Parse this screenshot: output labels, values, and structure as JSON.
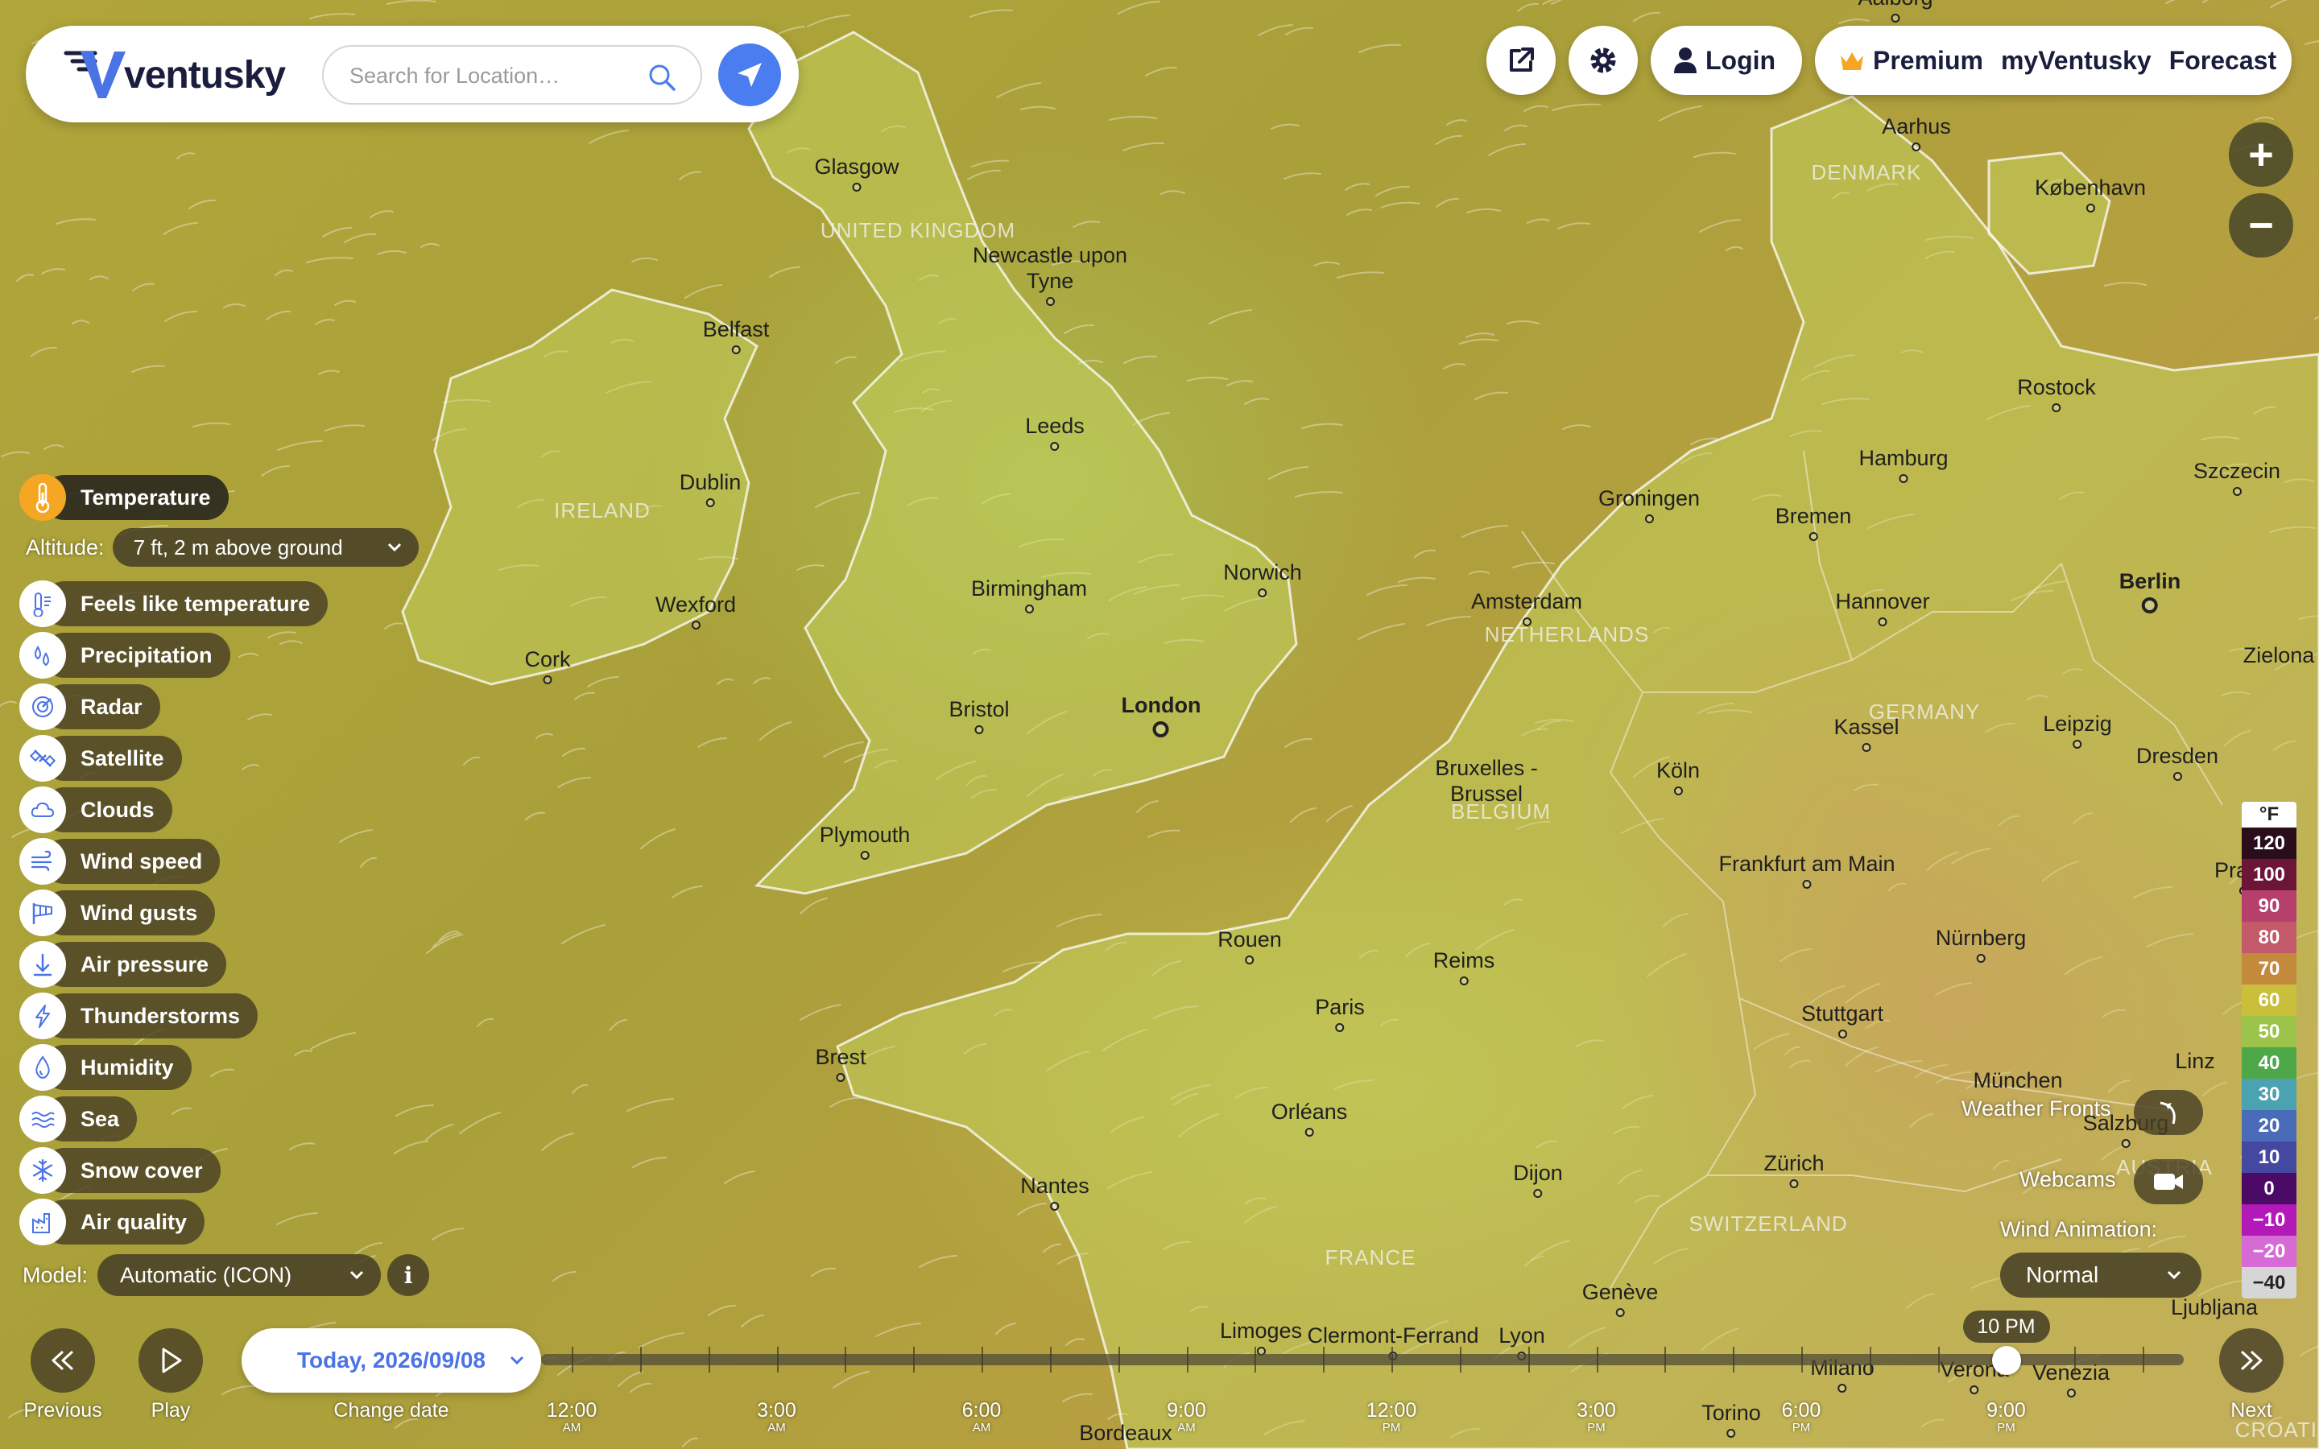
{
  "header": {
    "brand": "ventusky",
    "search_placeholder": "Search for Location…",
    "login_label": "Login",
    "premium_label": "Premium",
    "my_label": "myVentusky",
    "forecast_label": "Forecast"
  },
  "colors": {
    "accent": "#4a7df0",
    "active_layer": "#f5a623"
  },
  "layers": {
    "active": "Temperature",
    "altitude_label": "Altitude:",
    "altitude_value": "7 ft, 2 m above ground",
    "items": [
      {
        "label": "Feels like temperature",
        "icon": "thermometer-lines-icon"
      },
      {
        "label": "Precipitation",
        "icon": "drops-icon"
      },
      {
        "label": "Radar",
        "icon": "radar-icon"
      },
      {
        "label": "Satellite",
        "icon": "satellite-icon"
      },
      {
        "label": "Clouds",
        "icon": "cloud-icon"
      },
      {
        "label": "Wind speed",
        "icon": "wind-icon"
      },
      {
        "label": "Wind gusts",
        "icon": "windsock-icon"
      },
      {
        "label": "Air pressure",
        "icon": "arrow-down-icon"
      },
      {
        "label": "Thunderstorms",
        "icon": "lightning-icon"
      },
      {
        "label": "Humidity",
        "icon": "droplet-icon"
      },
      {
        "label": "Sea",
        "icon": "waves-icon"
      },
      {
        "label": "Snow cover",
        "icon": "snowflake-icon"
      },
      {
        "label": "Air quality",
        "icon": "factory-icon"
      }
    ],
    "model_label": "Model:",
    "model_value": "Automatic (ICON)"
  },
  "legend": {
    "unit": "°F",
    "values": [
      "120",
      "100",
      "90",
      "80",
      "70",
      "60",
      "50",
      "40",
      "30",
      "20",
      "10",
      "0",
      "−10",
      "−20",
      "−40"
    ],
    "colors": [
      "#2a0d1a",
      "#6b1537",
      "#b6406b",
      "#c25a6a",
      "#c48a3c",
      "#c9bf3a",
      "#9dc44a",
      "#4ea84a",
      "#4ba2b0",
      "#4a6cb8",
      "#4548a0",
      "#4a0a66",
      "#b318b8",
      "#d66bd6",
      "#d6d6d6"
    ]
  },
  "tools": {
    "weather_fronts": "Weather Fronts",
    "webcams": "Webcams",
    "wind_animation_label": "Wind Animation:",
    "wind_animation_value": "Normal"
  },
  "timeline": {
    "previous": "Previous",
    "play": "Play",
    "date": "Today, 2026/09/08",
    "change_date": "Change date",
    "next": "Next",
    "current_time": "10 PM",
    "current_fraction": 0.875,
    "hours": [
      {
        "t": "12:00",
        "ap": "AM"
      },
      {
        "t": "3:00",
        "ap": "AM"
      },
      {
        "t": "6:00",
        "ap": "AM"
      },
      {
        "t": "9:00",
        "ap": "AM"
      },
      {
        "t": "12:00",
        "ap": "PM"
      },
      {
        "t": "3:00",
        "ap": "PM"
      },
      {
        "t": "6:00",
        "ap": "PM"
      },
      {
        "t": "9:00",
        "ap": "PM"
      }
    ]
  },
  "map": {
    "cities": [
      "Aalborg",
      "Glasgow",
      "Newcastle upon Tyne",
      "Belfast",
      "Aarhus",
      "København",
      "Dublin",
      "Leeds",
      "Rostock",
      "Hamburg",
      "Szczecin",
      "Groningen",
      "Bremen",
      "Wexford",
      "Cork",
      "Birmingham",
      "Norwich",
      "Amsterdam",
      "Hannover",
      "Berlin",
      "Zielona",
      "London",
      "Bristol",
      "Kassel",
      "Leipzig",
      "Dresden",
      "Bruxelles - Brussel",
      "Köln",
      "Plymouth",
      "Frankfurt am Main",
      "Praha",
      "Nürnberg",
      "Rouen",
      "Reims",
      "Paris",
      "Stuttgart",
      "Brest",
      "Orléans",
      "München",
      "Salzburg",
      "Linz",
      "Nantes",
      "Dijon",
      "Zürich",
      "Genève",
      "Limoges",
      "Clermont-Ferrand",
      "Lyon",
      "Milano",
      "Verona",
      "Venezia",
      "Ljubljana",
      "Torino",
      "Bordeaux"
    ],
    "countries": [
      "UNITED KINGDOM",
      "IRELAND",
      "DENMARK",
      "NETHERLANDS",
      "GERMANY",
      "BELGIUM",
      "FRANCE",
      "SWITZERLAND",
      "AUSTRIA",
      "CROATIA"
    ]
  }
}
